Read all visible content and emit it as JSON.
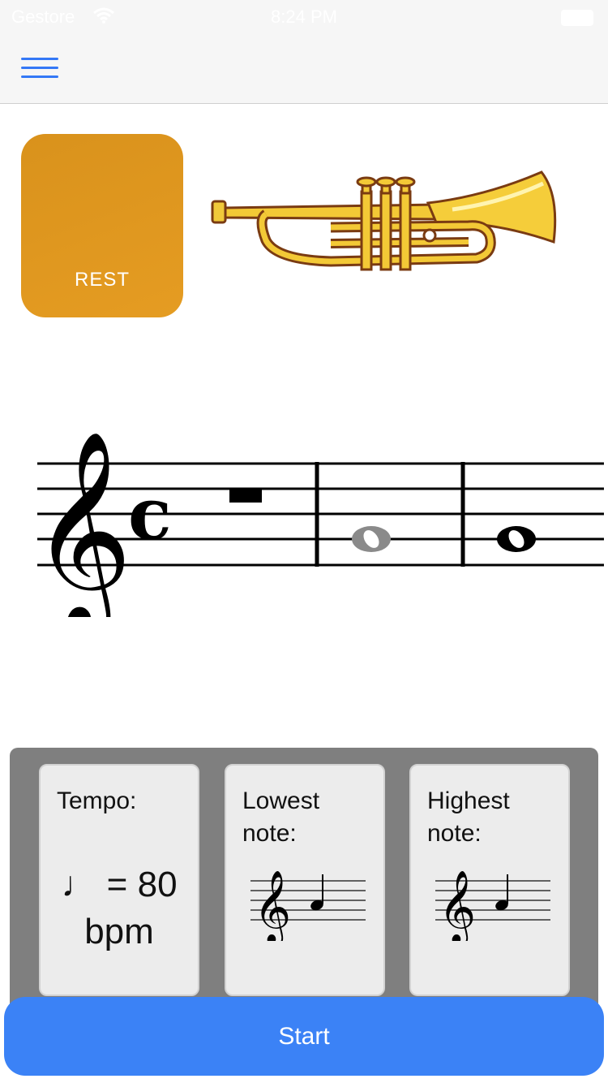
{
  "status_bar": {
    "carrier": "Gestore",
    "time": "8:24 PM"
  },
  "nav": {
    "menu_icon": "hamburger-menu-icon"
  },
  "rest_tile": {
    "label": "REST"
  },
  "instrument": {
    "icon": "trumpet-illustration"
  },
  "notation": {
    "clef": "treble",
    "time_signature": "C",
    "elements": [
      "whole rest",
      "whole note (grey)",
      "whole note"
    ]
  },
  "settings": {
    "tempo": {
      "title": "Tempo:",
      "value_line1": "♩ = 80",
      "value_line2": "bpm"
    },
    "lowest_note": {
      "title": "Lowest note:"
    },
    "highest_note": {
      "title": "Highest note:"
    }
  },
  "start_button": {
    "label": "Start"
  },
  "colors": {
    "accent": "#3b82f6",
    "rest_tile": "#df971f",
    "panel": "#7f7f7f",
    "card": "#ececec"
  }
}
